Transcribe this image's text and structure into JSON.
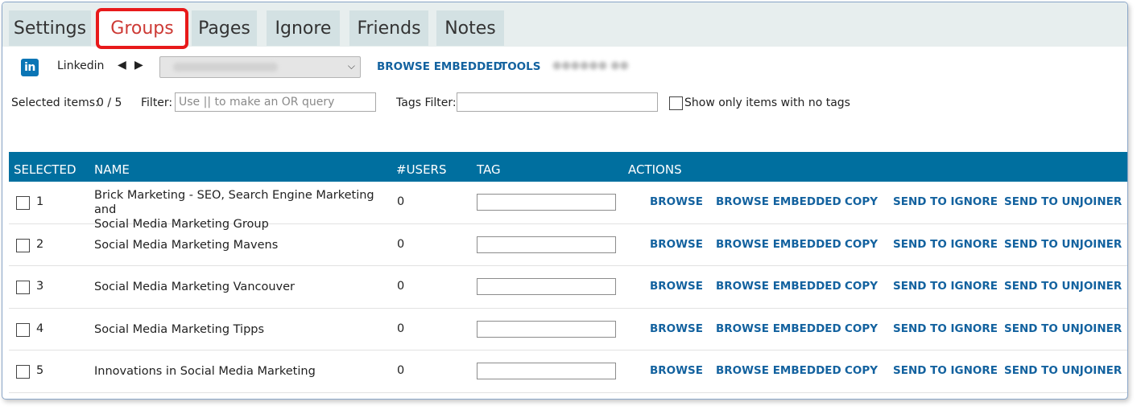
{
  "tabs": [
    {
      "label": "Settings",
      "active": false
    },
    {
      "label": "Groups",
      "active": true
    },
    {
      "label": "Pages",
      "active": false
    },
    {
      "label": "Ignore",
      "active": false
    },
    {
      "label": "Friends",
      "active": false
    },
    {
      "label": "Notes",
      "active": false
    }
  ],
  "toolbar": {
    "network_icon": "linkedin-icon",
    "network_icon_text": "in",
    "network_label": "Linkedin",
    "prev_arrow": "◀",
    "next_arrow": "▶",
    "account_select_chevron": "⌵",
    "browse_embedded_label": "BROWSE EMBEDDED",
    "tools_label": "TOOLS"
  },
  "filters": {
    "selected_label": "Selected items:",
    "selected_value": "0 / 5",
    "filter_label": "Filter:",
    "filter_placeholder": "Use || to make an OR query",
    "filter_value": "",
    "tags_filter_label": "Tags Filter:",
    "tags_filter_value": "",
    "no_tags_label": "Show only items with no tags",
    "no_tags_checked": false
  },
  "table": {
    "columns": [
      "SELECTED",
      "NAME",
      "#USERS",
      "TAG",
      "ACTIONS"
    ],
    "action_labels": [
      "BROWSE",
      "BROWSE EMBEDDED",
      "COPY",
      "SEND TO IGNORE",
      "SEND TO UNJOINER"
    ],
    "rows": [
      {
        "num": "1",
        "name": "Brick Marketing - SEO, Search Engine Marketing and Social Media Marketing Group",
        "name_line1": "Brick Marketing - SEO, Search Engine Marketing and",
        "name_line2": "Social Media Marketing Group",
        "users": "0",
        "tag": "",
        "selected": false
      },
      {
        "num": "2",
        "name": "Social Media Marketing Mavens",
        "users": "0",
        "tag": "",
        "selected": false
      },
      {
        "num": "3",
        "name": "Social Media Marketing Vancouver",
        "users": "0",
        "tag": "",
        "selected": false
      },
      {
        "num": "4",
        "name": "Social Media Marketing Tipps",
        "users": "0",
        "tag": "",
        "selected": false
      },
      {
        "num": "5",
        "name": "Innovations in Social Media Marketing",
        "users": "0",
        "tag": "",
        "selected": false
      }
    ]
  },
  "colors": {
    "header_blue": "#006f9f",
    "link_blue": "#13629f",
    "active_tab_text": "#cd3a35",
    "highlight_red": "#e8191a",
    "tab_bg": "#d3e1e3"
  }
}
